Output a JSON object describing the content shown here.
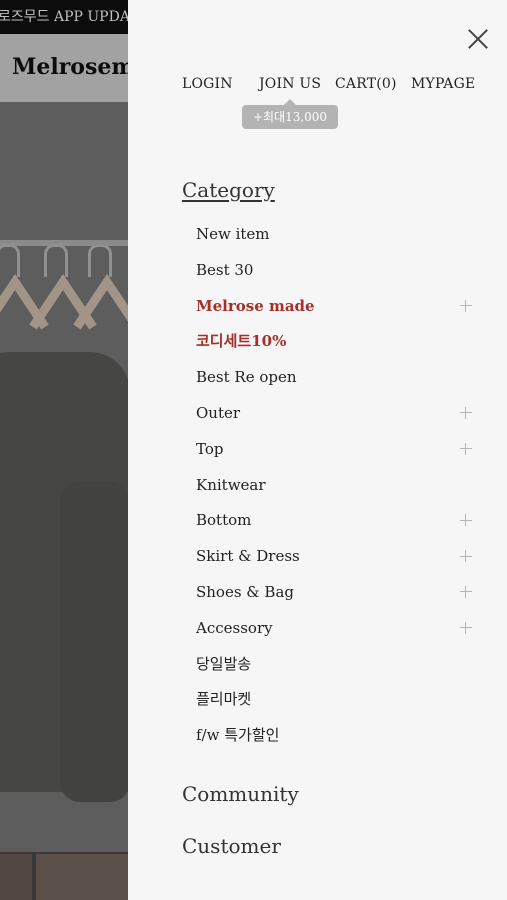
{
  "background": {
    "banner_text": "로즈무드 APP UPDA",
    "logo_text": "Melrosem"
  },
  "drawer": {
    "top_links": {
      "login": "LOGIN",
      "join": "JOIN US",
      "cart": "CART(0)",
      "mypage": "MYPAGE"
    },
    "join_badge": "+최대13,000",
    "category_title": "Category",
    "category_items": [
      {
        "label": "New item",
        "expandable": false,
        "highlight": false
      },
      {
        "label": "Best 30",
        "expandable": false,
        "highlight": false
      },
      {
        "label": "Melrose made",
        "expandable": true,
        "highlight": true
      },
      {
        "label": "코디세트10%",
        "expandable": false,
        "highlight": true
      },
      {
        "label": "Best Re open",
        "expandable": false,
        "highlight": false
      },
      {
        "label": "Outer",
        "expandable": true,
        "highlight": false
      },
      {
        "label": "Top",
        "expandable": true,
        "highlight": false
      },
      {
        "label": "Knitwear",
        "expandable": false,
        "highlight": false
      },
      {
        "label": "Bottom",
        "expandable": true,
        "highlight": false
      },
      {
        "label": "Skirt & Dress",
        "expandable": true,
        "highlight": false
      },
      {
        "label": "Shoes & Bag",
        "expandable": true,
        "highlight": false
      },
      {
        "label": "Accessory",
        "expandable": true,
        "highlight": false
      },
      {
        "label": "당일발송",
        "expandable": false,
        "highlight": false
      },
      {
        "label": "플리마켓",
        "expandable": false,
        "highlight": false
      },
      {
        "label": "f/w 특가할인",
        "expandable": false,
        "highlight": false
      }
    ],
    "community_title": "Community",
    "customer_title": "Customer"
  },
  "colors": {
    "highlight": "#a4302a",
    "drawer_bg": "#f6f6f6",
    "badge_bg": "#b3b3b3"
  }
}
